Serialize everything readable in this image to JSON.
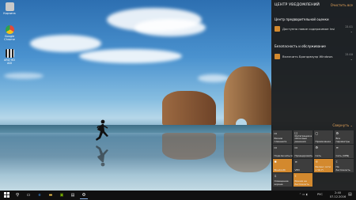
{
  "desktop_icons": [
    {
      "label": "Корзина",
      "color": "#c9c9c9"
    },
    {
      "label": "Google Chrome",
      "color": "#e04a3b"
    },
    {
      "label": "ARD HD ADI",
      "color": "#f4f4f4"
    }
  ],
  "action_center": {
    "title": "ЦЕНТР УВЕДОМЛЕНИЙ",
    "clear_all": "Очистить все",
    "groups": [
      {
        "name": "Центр предварительной оценки",
        "notif": {
          "text": "Доступно новое содержимое Insi",
          "time": "21:11"
        }
      },
      {
        "name": "Безопасность и обслуживание",
        "notif": {
          "text": "Включить Брандмауэр Windows",
          "time": "21:10"
        }
      }
    ],
    "collapse": "Свернуть ⌄",
    "tiles": [
      {
        "label": "Режим планшета",
        "icon": "▭",
        "active": false
      },
      {
        "label": "Интеграция в облачные решения",
        "icon": "☐",
        "active": false
      },
      {
        "label": "Примечание",
        "icon": "▢",
        "active": false
      },
      {
        "label": "Все параметры",
        "icon": "⚙",
        "active": false
      },
      {
        "label": "Подключиться",
        "icon": "▭",
        "active": false
      },
      {
        "label": "Проецировать",
        "icon": "▭",
        "active": false
      },
      {
        "label": "Сеть",
        "icon": "⚙",
        "active": false
      },
      {
        "label": "Сеть (VPN)",
        "icon": "∞",
        "active": false
      },
      {
        "label": "Bluetooth",
        "icon": "✱",
        "active": true
      },
      {
        "label": "VPN",
        "icon": "∞",
        "active": false
      },
      {
        "label": "Баланс сети и Wi-Fi",
        "icon": "☼",
        "active": true
      },
      {
        "label": "Не беспокоить",
        "icon": "☾",
        "active": false
      },
      {
        "label": "Освещение экрана",
        "icon": "⇩",
        "active": false
      },
      {
        "label": "Режим не беспокоить",
        "icon": "☾",
        "active": true
      }
    ]
  },
  "taskbar": {
    "clock_time": "2:40",
    "clock_date": "07.12.2016",
    "lang": "РУС"
  }
}
